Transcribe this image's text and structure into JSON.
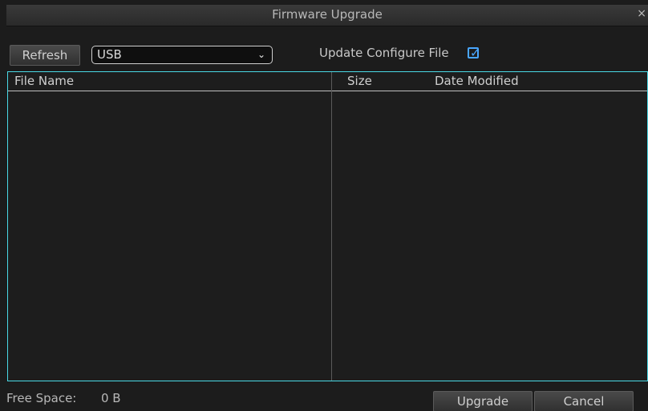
{
  "dialog": {
    "title": "Firmware Upgrade",
    "close_glyph": "×"
  },
  "toolbar": {
    "refresh_label": "Refresh",
    "device_select": {
      "selected": "USB",
      "chevron_glyph": "⌄"
    },
    "update_config_label": "Update Configure File",
    "update_config_checked": true,
    "check_glyph": "✓"
  },
  "table": {
    "columns": {
      "name": "File Name",
      "size": "Size",
      "date": "Date Modified"
    },
    "rows": []
  },
  "footer": {
    "free_space_label": "Free Space:",
    "free_space_value": "0 B",
    "upgrade_label": "Upgrade",
    "cancel_label": "Cancel"
  },
  "colors": {
    "background": "#1c1c1c",
    "accent": "#49d9e6",
    "checkbox": "#49a6ff"
  }
}
